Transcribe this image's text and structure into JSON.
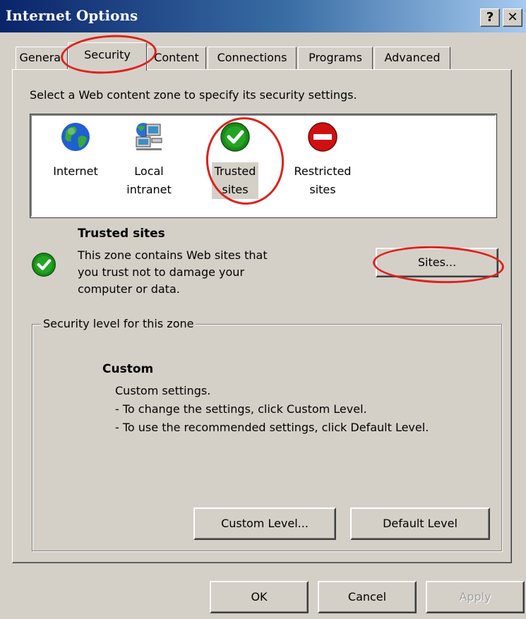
{
  "window": {
    "title": "Internet Options"
  },
  "titlebar_buttons": {
    "help": "?",
    "close": "✕"
  },
  "tabs": [
    {
      "label": "General"
    },
    {
      "label": "Security"
    },
    {
      "label": "Content"
    },
    {
      "label": "Connections"
    },
    {
      "label": "Programs"
    },
    {
      "label": "Advanced"
    }
  ],
  "active_tab": "Security",
  "instruction": "Select a Web content zone to specify its security settings.",
  "zones": [
    {
      "line1": "Internet",
      "line2": "",
      "icon": "globe-icon"
    },
    {
      "line1": "Local",
      "line2": "intranet",
      "icon": "network-computer-icon"
    },
    {
      "line1": "Trusted",
      "line2": "sites",
      "icon": "green-check-icon"
    },
    {
      "line1": "Restricted",
      "line2": "sites",
      "icon": "red-no-entry-icon"
    }
  ],
  "selected_zone": "Trusted sites",
  "zone_info": {
    "title": "Trusted sites",
    "description": "This zone contains Web sites that\nyou trust not to damage your\ncomputer or data.",
    "sites_button": "Sites..."
  },
  "security_level": {
    "legend": "Security level for this zone",
    "title": "Custom",
    "lines": [
      "Custom settings.",
      "- To change the settings, click Custom Level.",
      "- To use the recommended settings, click Default Level."
    ],
    "custom_level_button": "Custom Level...",
    "default_level_button": "Default Level"
  },
  "footer": {
    "ok": "OK",
    "cancel": "Cancel",
    "apply": "Apply"
  },
  "colors": {
    "annotation": "#e0201c",
    "titlebar": "#0a246a",
    "face": "#d4d0c8"
  }
}
